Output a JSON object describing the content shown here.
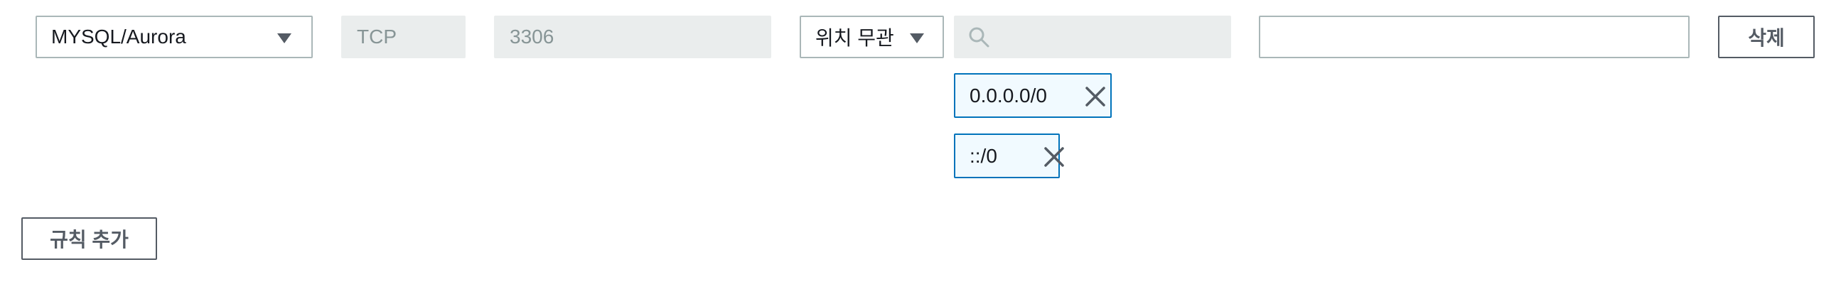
{
  "rule": {
    "type": {
      "selected": "MYSQL/Aurora"
    },
    "protocol": {
      "value": "TCP"
    },
    "port_range": {
      "value": "3306"
    },
    "source": {
      "selected": "위치 무관"
    },
    "cidr_search": {
      "placeholder": ""
    },
    "cidr_tokens": [
      {
        "label": "0.0.0.0/0"
      },
      {
        "label": "::/0"
      }
    ],
    "description": {
      "value": ""
    },
    "delete_label": "삭제"
  },
  "add_rule_label": "규칙 추가",
  "icons": {
    "type_dropdown": "caret-down-icon",
    "source_dropdown": "caret-down-icon",
    "search": "search-icon",
    "token_remove": "close-icon"
  },
  "colors": {
    "disabled_bg": "#eaeded",
    "disabled_text": "#879596",
    "token_border": "#0073bb",
    "token_bg": "#f1faff",
    "button_border": "#545b64"
  }
}
